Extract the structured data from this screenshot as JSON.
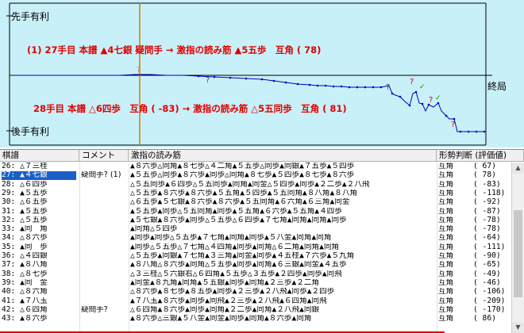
{
  "graph": {
    "label_top": "先手有利",
    "label_bottom": "後手有利",
    "label_end": "終局",
    "annotation1": "(1) 27手目 本譜 ▲4七銀 疑問手 → 激指の読み筋 ▲5五歩　互角 ( 78)",
    "annotation2": "28手目 本譜 △6四歩　互角 ( -83) → 激指の読み筋 △5五同歩　互角 ( 81)",
    "colors": {
      "background": "#c8f0f8",
      "line": "#0000c0",
      "annotation": "#e00000",
      "marker": "#d08000"
    }
  },
  "table": {
    "headers": {
      "move": "棋譜",
      "comment": "コメント",
      "variation": "激指の読み筋",
      "judge": "形勢判断 (評価値)"
    },
    "rows": [
      {
        "move": "26: △７三桂",
        "comment": "",
        "variation": "▲８六歩△同角▲８七歩△４二角▲５五歩△同歩▲同銀▲７五歩▲５四歩",
        "judge": "互角",
        "eval": "(    67)"
      },
      {
        "move": "27: ▲４七銀",
        "comment": "疑問手? (1)",
        "variation": "▲５五歩△同歩▲８六歩▲同歩△同角▲８七歩▲５四歩▲８七歩▲８六歩",
        "judge": "互角",
        "eval": "(    78)",
        "selected": true
      },
      {
        "move": "28: △６四歩",
        "comment": "",
        "variation": "△５五同歩▲６四歩△５五同歩▲同角▲同金△５四歩▲同歩▲２二歩▲２八飛",
        "judge": "互角",
        "eval": "(   -83)"
      },
      {
        "move": "29: ▲５五歩",
        "comment": "",
        "variation": "△５五歩▲８六歩▲８六歩▲５五角▲５四歩▲５五同角▲８八角▲８八角",
        "judge": "互角",
        "eval": "(  -118)"
      },
      {
        "move": "30: △６五歩",
        "comment": "",
        "variation": "△６五歩▲５七銀▲８六歩▲８六歩▲５五同角▲６六角▲６三角▲同金",
        "judge": "互角",
        "eval": "(   -92)"
      },
      {
        "move": "31: ▲５五歩",
        "comment": "",
        "variation": "▲５五歩▲同歩△５五同角▲同歩▲５五角▲６六歩▲５五角▲４四歩",
        "judge": "互角",
        "eval": "(   -87)"
      },
      {
        "move": "32: △５五歩",
        "comment": "",
        "variation": "▲５七銀▲８六歩▲同歩△５五歩△６四歩▲７七角▲同角▲同角▲同歩",
        "judge": "互角",
        "eval": "(   -78)"
      },
      {
        "move": "33: ▲同　角",
        "comment": "",
        "variation": "▲同角△５四歩",
        "judge": "互角",
        "eval": "(   -78)"
      },
      {
        "move": "34: △８六歩",
        "comment": "",
        "variation": "▲同歩▲同歩△５五歩▲７七角▲同角▲同歩▲５八金▲同角▲同角",
        "judge": "互角",
        "eval": "(   -64)"
      },
      {
        "move": "35: ▲同　歩",
        "comment": "",
        "variation": "▲同歩△５五歩△７七角△４四角▲同歩▲同角△６二角▲同角▲同角",
        "judge": "互角",
        "eval": "(  -111)"
      },
      {
        "move": "36: △４四銀",
        "comment": "",
        "variation": "△５五歩▲同銀▲７七角▲３三角▲同金▲同歩▲４五桂▲７六歩▲５九角",
        "judge": "互角",
        "eval": "(   -90)"
      },
      {
        "move": "37: ▲８八角",
        "comment": "",
        "variation": "▲８八角△８六歩▲同角△５五歩▲同歩▲同角▲６三銀▲同金▲４五歩",
        "judge": "互角",
        "eval": "(   -65)"
      },
      {
        "move": "38: △８七歩",
        "comment": "",
        "variation": "△３三桂△５六銀右△６四角▲５五歩△３五歩▲２四歩▲同歩▲同飛",
        "judge": "互角",
        "eval": "(   -49)"
      },
      {
        "move": "39: ▲同　金",
        "comment": "",
        "variation": "▲同金▲８九角▲同角▲５五銀▲同歩▲同角▲２三歩▲２二角",
        "judge": "互角",
        "eval": "(   -46)"
      },
      {
        "move": "40: △８六角",
        "comment": "",
        "variation": "△８六歩▲８七歩▲８五歩▲同歩▲２三歩▲２八飛▲同歩▲２四歩",
        "judge": "互角",
        "eval": "(  -106)"
      },
      {
        "move": "41: ▲７八玉",
        "comment": "",
        "variation": "▲７八玉▲８六歩▲同歩▲同飛▲２三歩▲２八飛▲６四角▲同飛",
        "judge": "互角",
        "eval": "(  -209)"
      },
      {
        "move": "42: △６四角",
        "comment": "疑問手?",
        "variation": "△６四角▲８六歩▲同歩▲同角▲２二歩▲同角▲２八飛▲同銀",
        "judge": "互角",
        "eval": "(  -170)"
      },
      {
        "move": "43: ▲８六歩",
        "comment": "",
        "variation": "▲８六歩△三銀▲５八金▲同金▲同歩▲同角▲８六歩▲同角",
        "judge": "互角",
        "eval": "(    86)"
      }
    ]
  }
}
